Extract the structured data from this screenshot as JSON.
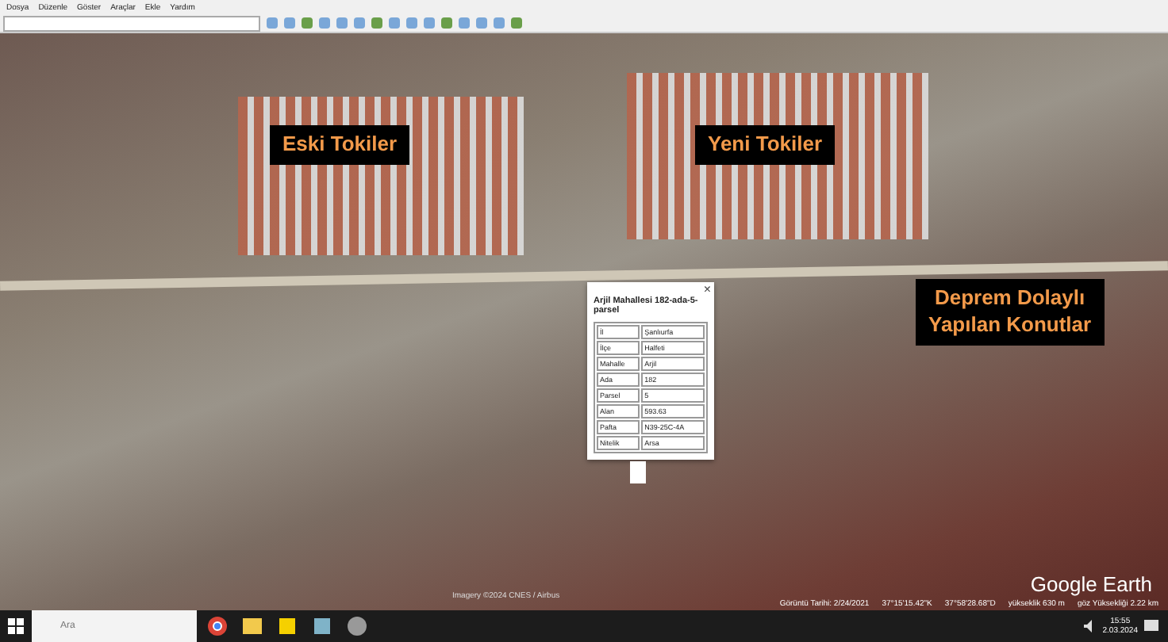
{
  "menu": [
    "Dosya",
    "Düzenle",
    "Göster",
    "Araçlar",
    "Ekle",
    "Yardım"
  ],
  "map": {
    "labels": [
      {
        "lines": [
          "Eski Tokiler"
        ]
      },
      {
        "lines": [
          "Yeni Tokiler"
        ]
      },
      {
        "lines": [
          "Deprem Dolaylı",
          "Yapılan Konutlar"
        ]
      }
    ],
    "popup": {
      "title": "Arjil Mahallesi 182-ada-5-parsel",
      "close": "×",
      "rows": [
        [
          "İl",
          "Şanlıurfa"
        ],
        [
          "İlçe",
          "Halfeti"
        ],
        [
          "Mahalle",
          "Arjil"
        ],
        [
          "Ada",
          "182"
        ],
        [
          "Parsel",
          "5"
        ],
        [
          "Alan",
          "593.63"
        ],
        [
          "Pafta",
          "N39-25C-4A"
        ],
        [
          "Nitelik",
          "Arsa"
        ]
      ]
    },
    "attribution": "Imagery ©2024 CNES / Airbus",
    "logo": "Google Earth",
    "status": [
      "Görüntü Tarihi: 2/24/2021",
      "37°15'15.42\"K",
      "37°58'28.68\"D",
      "yükseklik 630 m",
      "göz Yüksekliği 2.22 km"
    ]
  },
  "taskbar": {
    "search": {
      "placeholder": "Ara"
    },
    "time": "15:55",
    "date": "2.03.2024"
  }
}
